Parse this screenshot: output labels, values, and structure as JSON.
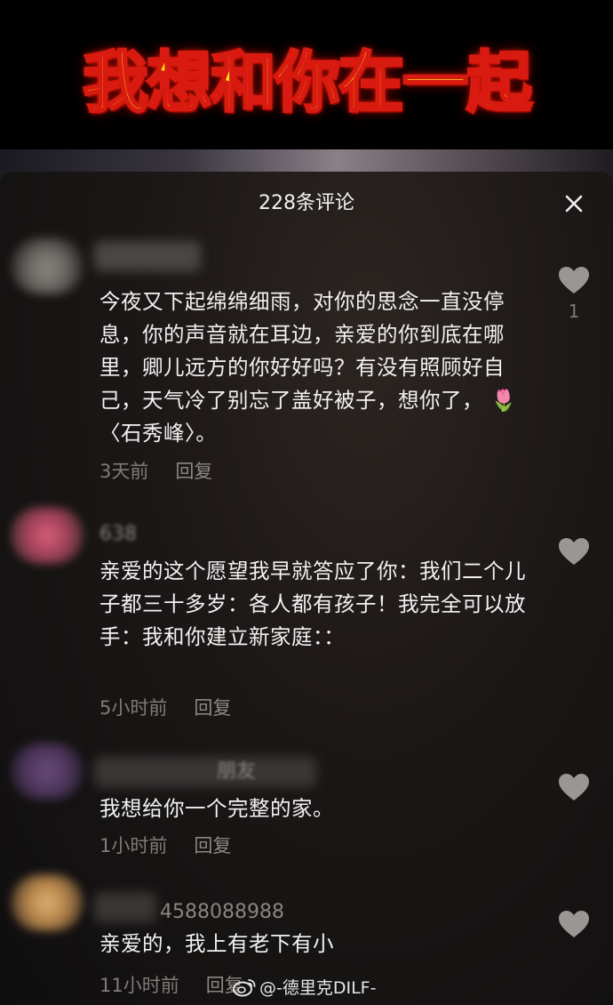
{
  "banner": {
    "title": "我想和你在一起"
  },
  "sheet": {
    "title": "228条评论"
  },
  "comments": [
    {
      "name": "",
      "text": "今夜又下起绵绵细雨，对你的思念一直没停息，你的声音就在耳边，亲爱的你到底在哪里，卿儿远方的你好好吗？有没有照顾好自己，天气冷了别忘了盖好被子，想你了， 🌷 〈石秀峰〉。",
      "time": "3天前",
      "reply": "回复",
      "likes": "1"
    },
    {
      "name": "638",
      "text": "亲爱的这个愿望我早就答应了你：我们二个儿子都三十多岁：各人都有孩子！我完全可以放手：我和你建立新家庭：：",
      "time": "5小时前",
      "reply": "回复",
      "likes": ""
    },
    {
      "name": "朋友",
      "text": "我想给你一个完整的家。",
      "time": "1小时前",
      "reply": "回复",
      "likes": ""
    },
    {
      "name": "4588088988",
      "text": "亲爱的，我上有老下有小",
      "time": "11小时前",
      "reply": "回复",
      "likes": ""
    }
  ],
  "watermark": {
    "text": "@-德里克DILF-"
  },
  "icons": {
    "close": "close-icon",
    "like": "heart-icon",
    "weibo": "weibo-icon"
  },
  "colors": {
    "banner_text": "#ffe21a",
    "banner_outline": "#d81a10",
    "like_icon": "#9a9693"
  }
}
